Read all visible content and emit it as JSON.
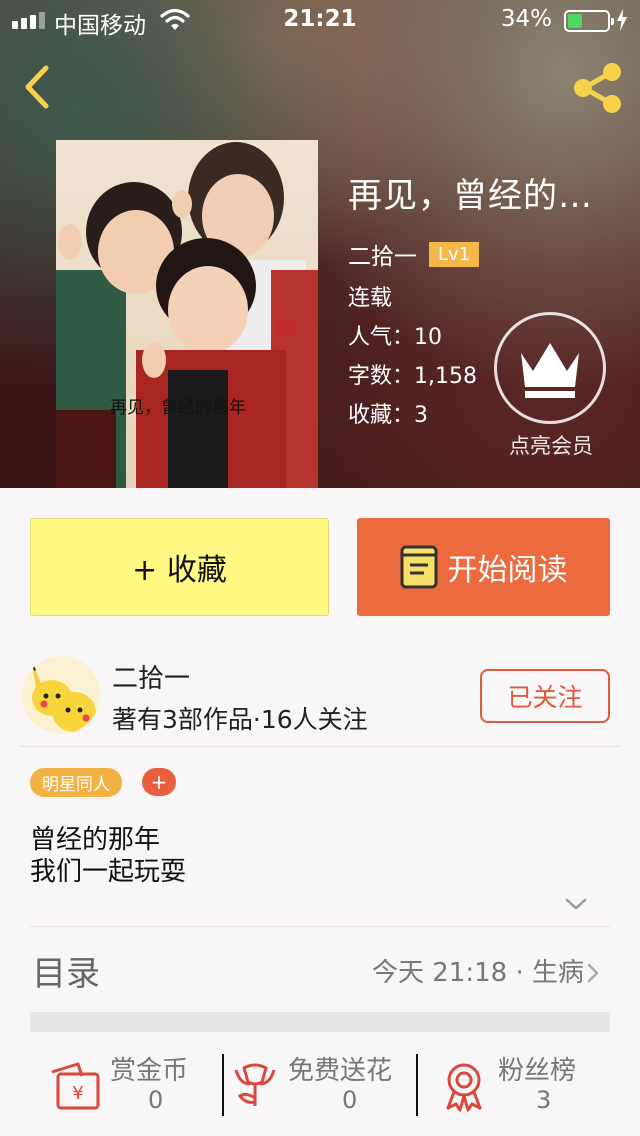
{
  "status_bar": {
    "carrier": "中国移动",
    "time": "21:21",
    "battery_percent": "34%",
    "battery_level": 0.34
  },
  "book": {
    "title": "再见，曾经的…",
    "cover_caption": "再见，曾经的那年",
    "author": "二拾一",
    "level": "Lv1",
    "status": "连载",
    "popularity": "人气：10",
    "word_count": "字数：1,158",
    "favorites": "收藏：3"
  },
  "vip": {
    "label": "点亮会员",
    "icon": "crown-icon"
  },
  "actions": {
    "collect_label": "+ 收藏",
    "read_label": "开始阅读"
  },
  "author_info": {
    "name": "二拾一",
    "stats": "著有3部作品·16人关注",
    "follow_label": "已关注"
  },
  "tags": {
    "items": [
      "明星同人"
    ],
    "add_label": "+"
  },
  "synopsis": {
    "lines": [
      "曾经的那年",
      "我们一起玩耍"
    ]
  },
  "toc": {
    "title": "目录",
    "latest": "今天 21:18 · 生病"
  },
  "bottom_bar": [
    {
      "label": "赏金币",
      "value": "0",
      "icon": "red-envelope-icon"
    },
    {
      "label": "免费送花",
      "value": "0",
      "icon": "flower-icon"
    },
    {
      "label": "粉丝榜",
      "value": "3",
      "icon": "medal-icon"
    }
  ],
  "colors": {
    "accent_orange": "#ec6b3e",
    "collect_yellow": "#fff984",
    "level_badge": "#f2b94a",
    "follow_red": "#e05a3d",
    "tag_orange": "#f4b245"
  }
}
